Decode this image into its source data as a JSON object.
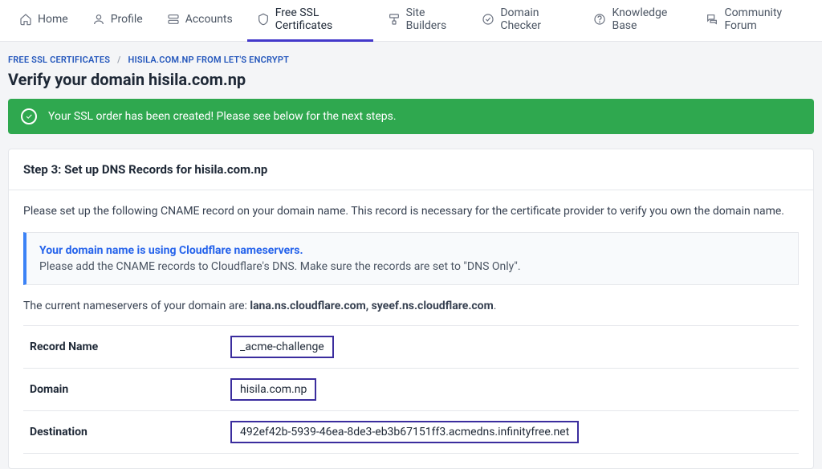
{
  "nav": {
    "home": "Home",
    "profile": "Profile",
    "accounts": "Accounts",
    "ssl": "Free SSL Certificates",
    "site_builders": "Site Builders",
    "domain_checker": "Domain Checker",
    "knowledge_base": "Knowledge Base",
    "forum": "Community Forum"
  },
  "breadcrumb": {
    "root": "FREE SSL CERTIFICATES",
    "leaf": "HISILA.COM.NP FROM LET'S ENCRYPT"
  },
  "page_title": "Verify your domain hisila.com.np",
  "alert": {
    "message": "Your SSL order has been created! Please see below for the next steps."
  },
  "panel": {
    "step_title": "Step 3: Set up DNS Records for hisila.com.np",
    "intro": "Please set up the following CNAME record on your domain name. This record is necessary for the certificate provider to verify you own the domain name.",
    "callout": {
      "title": "Your domain name is using Cloudflare nameservers.",
      "body": "Please add the CNAME records to Cloudflare's DNS. Make sure the records are set to \"DNS Only\"."
    },
    "ns_prefix": "The current nameservers of your domain are: ",
    "ns_list": "lana.ns.cloudflare.com, syeef.ns.cloudflare.com",
    "ns_suffix": ".",
    "rows": {
      "record_name": {
        "label": "Record Name",
        "value": "_acme-challenge"
      },
      "domain": {
        "label": "Domain",
        "value": "hisila.com.np"
      },
      "destination": {
        "label": "Destination",
        "value": "492ef42b-5939-46ea-8de3-eb3b67151ff3.acmedns.infinityfree.net"
      }
    }
  }
}
